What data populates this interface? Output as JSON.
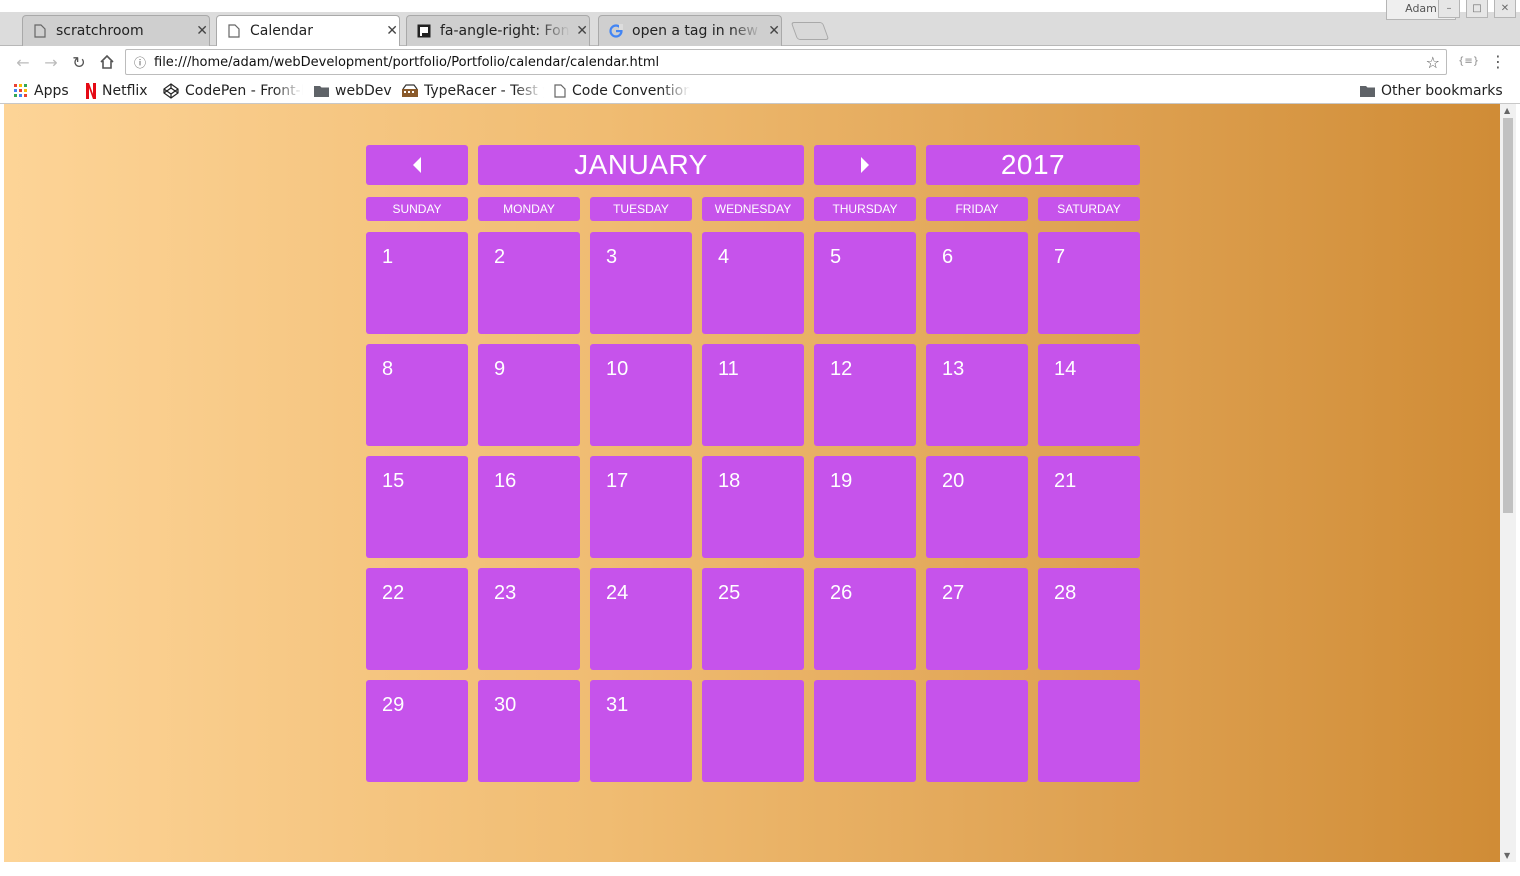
{
  "browser": {
    "tabs": [
      {
        "title": "scratchroom",
        "icon": "document-icon",
        "active": false
      },
      {
        "title": "Calendar",
        "icon": "document-icon",
        "active": true
      },
      {
        "title": "fa-angle-right: Font",
        "icon": "flag-icon",
        "active": false
      },
      {
        "title": "open a tag in new t",
        "icon": "google-icon",
        "active": false
      }
    ],
    "profile": "Adam",
    "url": "file:///home/adam/webDevelopment/portfolio/Portfolio/calendar/calendar.html",
    "bookmarks": [
      {
        "label": "Apps",
        "icon": "apps-grid-icon"
      },
      {
        "label": "Netflix",
        "icon": "netflix-icon"
      },
      {
        "label": "CodePen - Front-End",
        "icon": "codepen-icon"
      },
      {
        "label": "webDev",
        "icon": "folder-icon"
      },
      {
        "label": "TypeRacer - Test your",
        "icon": "typeracer-icon"
      },
      {
        "label": "Code Conventions",
        "icon": "document-icon"
      }
    ],
    "other_bookmarks": "Other bookmarks"
  },
  "calendar": {
    "month": "JANUARY",
    "year": "2017",
    "prev_icon": "caret-left-icon",
    "next_icon": "caret-right-icon",
    "weekdays": [
      "SUNDAY",
      "MONDAY",
      "TUESDAY",
      "WEDNESDAY",
      "THURSDAY",
      "FRIDAY",
      "SATURDAY"
    ],
    "weeks": [
      [
        "1",
        "2",
        "3",
        "4",
        "5",
        "6",
        "7"
      ],
      [
        "8",
        "9",
        "10",
        "11",
        "12",
        "13",
        "14"
      ],
      [
        "15",
        "16",
        "17",
        "18",
        "19",
        "20",
        "21"
      ],
      [
        "22",
        "23",
        "24",
        "25",
        "26",
        "27",
        "28"
      ],
      [
        "29",
        "30",
        "31",
        "",
        "",
        "",
        ""
      ]
    ]
  },
  "colors": {
    "cell": "#c653eb",
    "gradient_start": "#fdd497",
    "gradient_end": "#d08c36",
    "text": "#ffffff"
  }
}
